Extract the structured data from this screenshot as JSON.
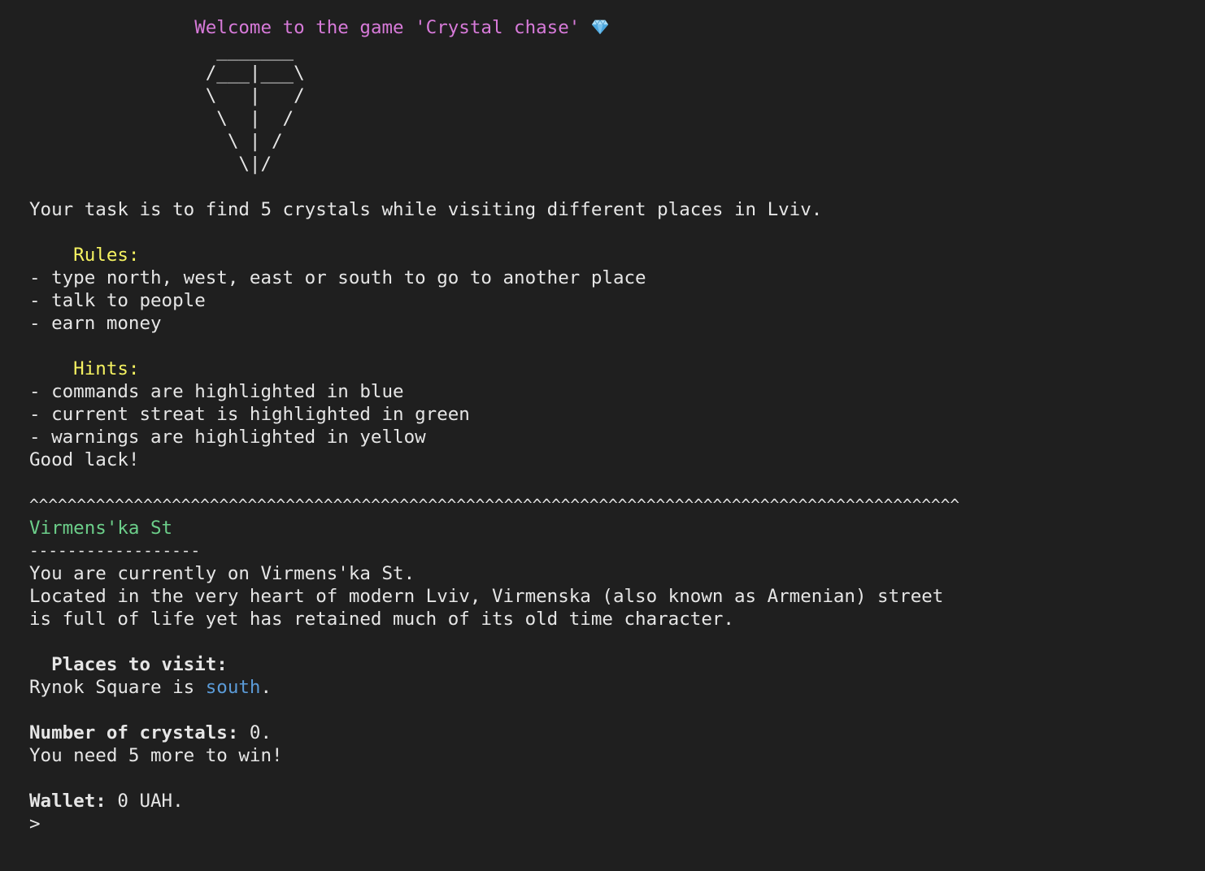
{
  "welcome": {
    "prefix_spaces": "               ",
    "text": "Welcome to the game 'Crystal chase'",
    "gem_icon": "diamond-icon"
  },
  "ascii_art": [
    "                 _______",
    "                /___|___\\",
    "                \\   |   /",
    "                 \\  |  /",
    "                  \\ | /",
    "                   \\|/"
  ],
  "task": "Your task is to find 5 crystals while visiting different places in Lviv.",
  "rules": {
    "heading": "    Rules:",
    "items": [
      "- type north, west, east or south to go to another place",
      "- talk to people",
      "- earn money"
    ]
  },
  "hints": {
    "heading": "    Hints:",
    "items": [
      "- commands are highlighted in blue",
      "- current streat is highlighted in green",
      "- warnings are highlighted in yellow"
    ],
    "footer": "Good lack!"
  },
  "separator": "^^^^^^^^^^^^^^^^^^^^^^^^^^^^^^^^^^^^^^^^^^^^^^^^^^^^^^^^^^^^^^^^^^^^^^^^^^^^^^^^^^^^^^^^^^^^^^^^^^",
  "location": {
    "name": "Virmens'ka St",
    "underline": "------------------",
    "current": "You are currently on Virmens'ka St.",
    "description_1": "Located in the very heart of modern Lviv, Virmenska (also known as Armenian) street",
    "description_2": "is full of life yet has retained much of its old time character."
  },
  "places": {
    "heading": "  Places to visit:",
    "item_prefix": "Rynok Square is ",
    "item_direction": "south",
    "item_suffix": "."
  },
  "crystals": {
    "label": "Number of crystals:",
    "value": " 0.",
    "need": "You need 5 more to win!"
  },
  "wallet": {
    "label": "Wallet:",
    "value": " 0 UAH."
  },
  "prompt": ">",
  "colors": {
    "background": "#1f1f1f",
    "text": "#e6e6e6",
    "title": "#d77ad9",
    "heading": "#f5f261",
    "street": "#6ccf8a",
    "command": "#5b9bd8"
  }
}
